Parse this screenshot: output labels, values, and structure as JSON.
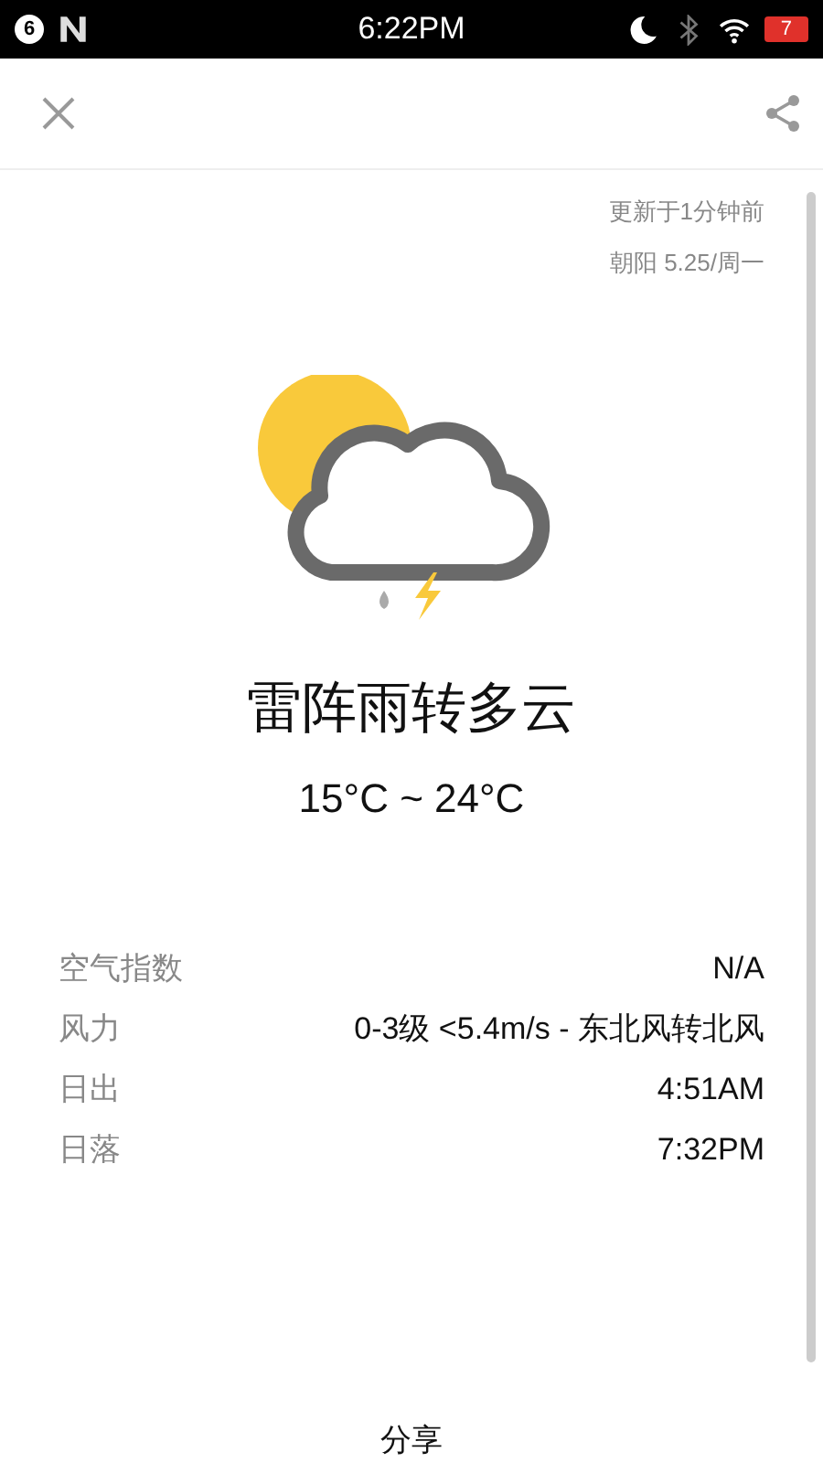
{
  "status_bar": {
    "notification_count": "6",
    "time": "6:22PM",
    "battery": "7"
  },
  "update": {
    "updated": "更新于1分钟前",
    "location_date": "朝阳  5.25/周一"
  },
  "weather": {
    "condition": "雷阵雨转多云",
    "temperature": "15°C ~ 24°C"
  },
  "details": [
    {
      "label": "空气指数",
      "value": "N/A"
    },
    {
      "label": "风力",
      "value": "0-3级 <5.4m/s - 东北风转北风"
    },
    {
      "label": "日出",
      "value": "4:51AM"
    },
    {
      "label": "日落",
      "value": "7:32PM"
    }
  ],
  "footer": {
    "share_label": "分享"
  }
}
